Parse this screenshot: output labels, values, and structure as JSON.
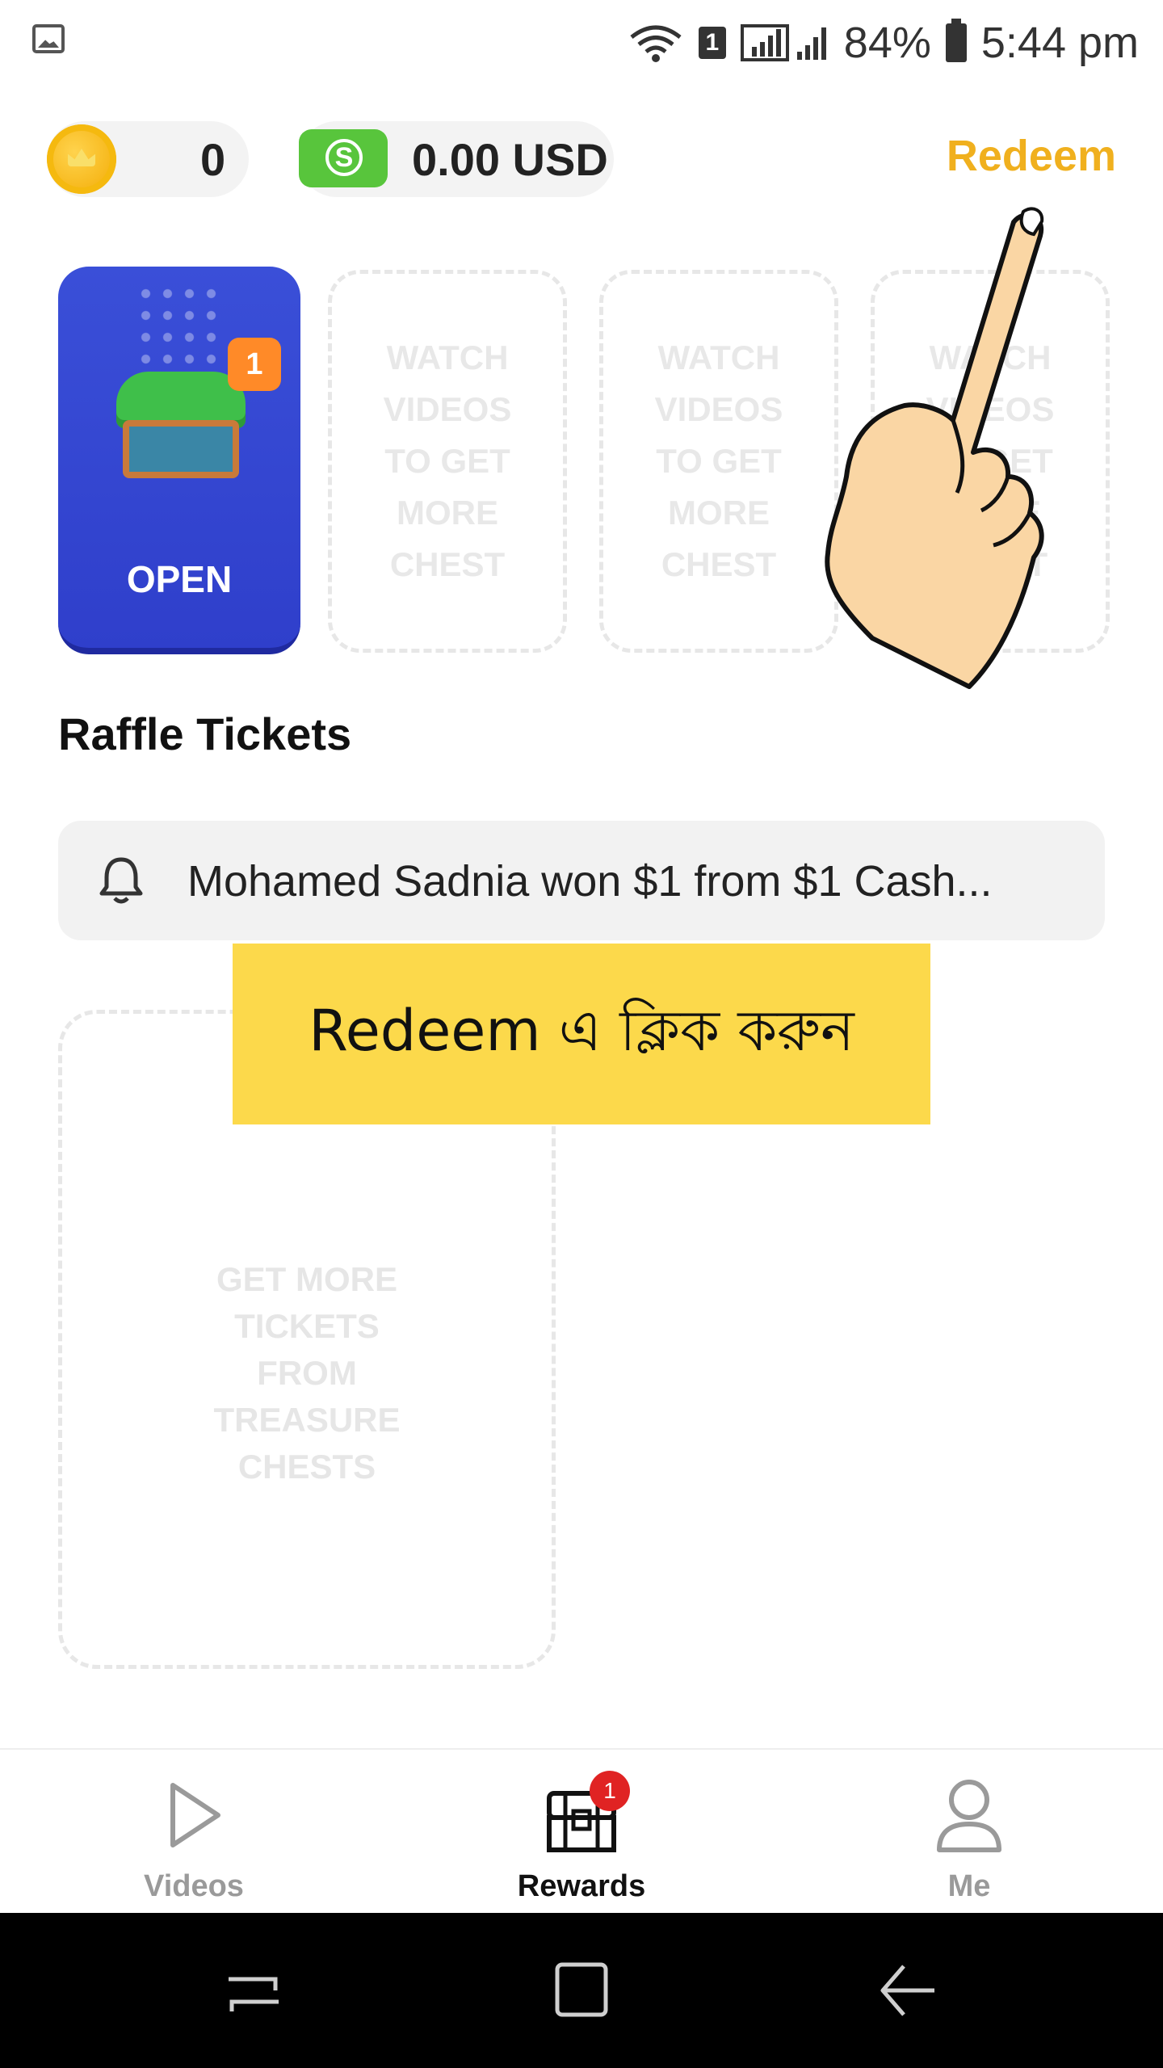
{
  "status_bar": {
    "battery": "84%",
    "time": "5:44 pm",
    "sim_slot": "1"
  },
  "balance": {
    "coins": "0",
    "cash": "0.00 USD",
    "cash_symbol": "S"
  },
  "header": {
    "redeem_label": "Redeem"
  },
  "chests": [
    {
      "badge": "1",
      "label": "OPEN"
    },
    {
      "label": "WATCH VIDEOS TO GET MORE CHEST"
    },
    {
      "label": "WATCH VIDEOS TO GET MORE CHEST"
    },
    {
      "label": "WATCH VIDEOS TO GET MORE CHEST"
    }
  ],
  "raffle": {
    "title": "Raffle Tickets",
    "notice": "Mohamed Sadnia won $1 from $1 Cash...",
    "ticket_slot_text": "GET MORE TICKETS FROM TREASURE CHESTS"
  },
  "overlay": {
    "hint": "Redeem এ ক্লিক করুন"
  },
  "bottom_nav": [
    {
      "label": "Videos",
      "icon": "play-icon",
      "active": false
    },
    {
      "label": "Rewards",
      "icon": "treasure-chest-icon",
      "active": true,
      "badge": "1"
    },
    {
      "label": "Me",
      "icon": "user-icon",
      "active": false
    }
  ],
  "colors": {
    "accent": "#f0b01e",
    "chest_card": "#3347d4",
    "badge_orange": "#ff8a28",
    "hint_bg": "#fcd94b",
    "nav_badge": "#e02323"
  }
}
